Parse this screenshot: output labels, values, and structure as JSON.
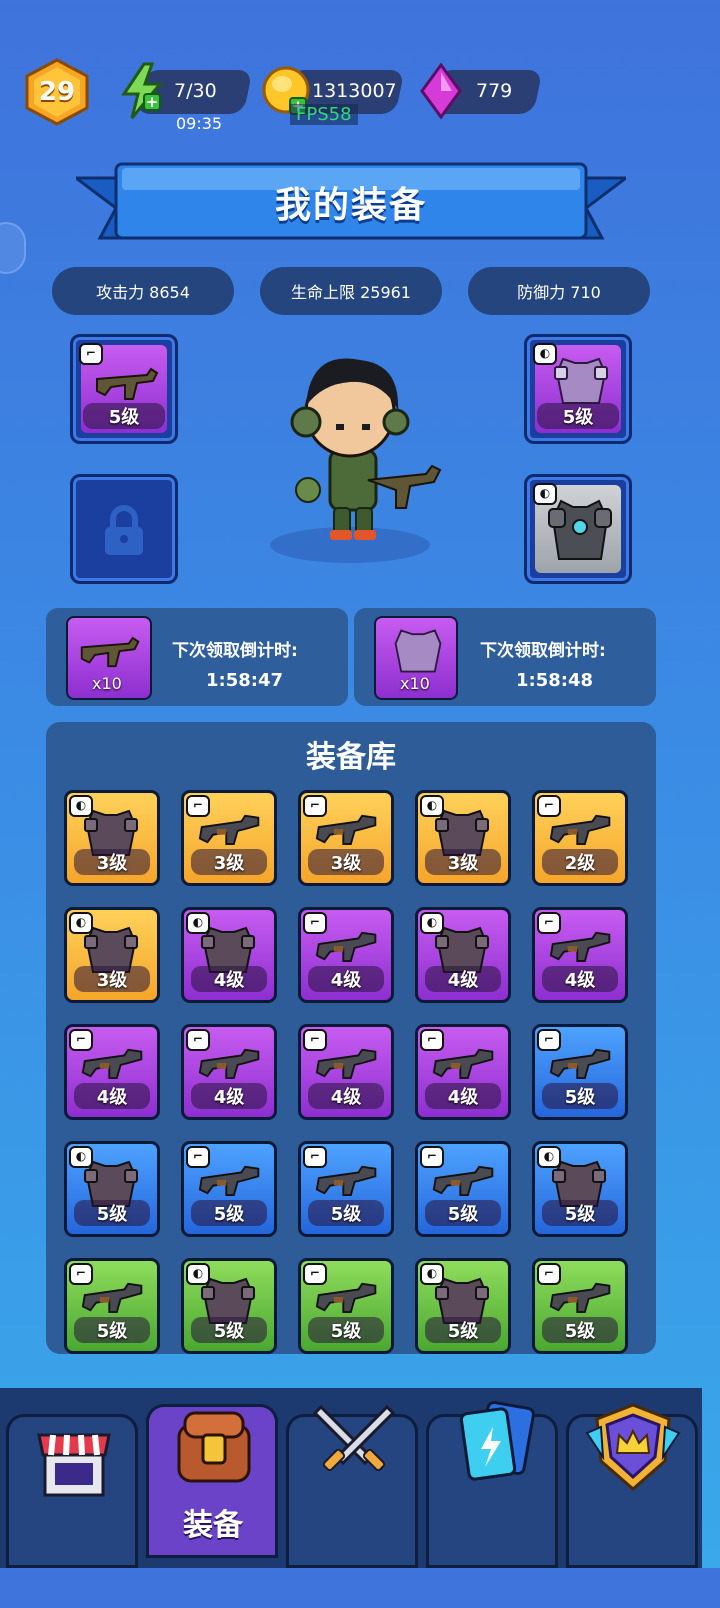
{
  "player": {
    "level": "29"
  },
  "resources": {
    "energy": "7/30",
    "energy_timer": "09:35",
    "gold": "1313007",
    "fps": "FPS58",
    "gems": "779"
  },
  "page": {
    "title": "我的装备"
  },
  "stats": [
    {
      "label": "攻击力 8654"
    },
    {
      "label": "生命上限 25961"
    },
    {
      "label": "防御力 710"
    }
  ],
  "equipped": {
    "weapon": {
      "level": "5级",
      "icon": "smg-icon"
    },
    "armor": {
      "level": "5级",
      "icon": "armor-vest-icon"
    },
    "locked": {
      "icon": "lock-icon"
    },
    "heavy_armor": {
      "icon": "heavy-armor-icon"
    }
  },
  "rewards": [
    {
      "count": "x10",
      "title": "下次领取倒计时:",
      "time": "1:58:47"
    },
    {
      "count": "x10",
      "title": "下次领取倒计时:",
      "time": "1:58:48"
    }
  ],
  "inventory": {
    "title": "装备库",
    "items": [
      {
        "rarity": "orange",
        "kind": "armor",
        "level": "3级"
      },
      {
        "rarity": "orange",
        "kind": "gun",
        "level": "3级"
      },
      {
        "rarity": "orange",
        "kind": "gun",
        "level": "3级"
      },
      {
        "rarity": "orange",
        "kind": "armor",
        "level": "3级"
      },
      {
        "rarity": "orange",
        "kind": "gun",
        "level": "2级"
      },
      {
        "rarity": "orange",
        "kind": "armor",
        "level": "3级"
      },
      {
        "rarity": "purple",
        "kind": "armor",
        "level": "4级"
      },
      {
        "rarity": "purple",
        "kind": "gun",
        "level": "4级"
      },
      {
        "rarity": "purple",
        "kind": "armor",
        "level": "4级"
      },
      {
        "rarity": "purple",
        "kind": "gun",
        "level": "4级"
      },
      {
        "rarity": "purple",
        "kind": "gun",
        "level": "4级"
      },
      {
        "rarity": "purple",
        "kind": "gun",
        "level": "4级"
      },
      {
        "rarity": "purple",
        "kind": "gun",
        "level": "4级"
      },
      {
        "rarity": "purple",
        "kind": "gun",
        "level": "4级"
      },
      {
        "rarity": "blue",
        "kind": "gun",
        "level": "5级"
      },
      {
        "rarity": "blue",
        "kind": "armor",
        "level": "5级"
      },
      {
        "rarity": "blue",
        "kind": "gun",
        "level": "5级"
      },
      {
        "rarity": "blue",
        "kind": "gun",
        "level": "5级"
      },
      {
        "rarity": "blue",
        "kind": "gun",
        "level": "5级"
      },
      {
        "rarity": "blue",
        "kind": "armor",
        "level": "5级"
      },
      {
        "rarity": "green",
        "kind": "gun",
        "level": "5级"
      },
      {
        "rarity": "green",
        "kind": "armor",
        "level": "5级"
      },
      {
        "rarity": "green",
        "kind": "gun",
        "level": "5级"
      },
      {
        "rarity": "green",
        "kind": "armor",
        "level": "5级"
      },
      {
        "rarity": "green",
        "kind": "gun",
        "level": "5级"
      }
    ]
  },
  "nav": {
    "items": [
      {
        "name": "shop",
        "icon": "shop-icon"
      },
      {
        "name": "equipment",
        "icon": "chest-icon",
        "label": "装备",
        "active": true
      },
      {
        "name": "battle",
        "icon": "crossed-swords-icon"
      },
      {
        "name": "cards",
        "icon": "cards-icon"
      },
      {
        "name": "rank",
        "icon": "crown-shield-icon"
      }
    ]
  },
  "colors": {
    "orange": "#f5a52a",
    "purple": "#8d2fd0",
    "blue": "#2566db",
    "green": "#4aa831"
  }
}
